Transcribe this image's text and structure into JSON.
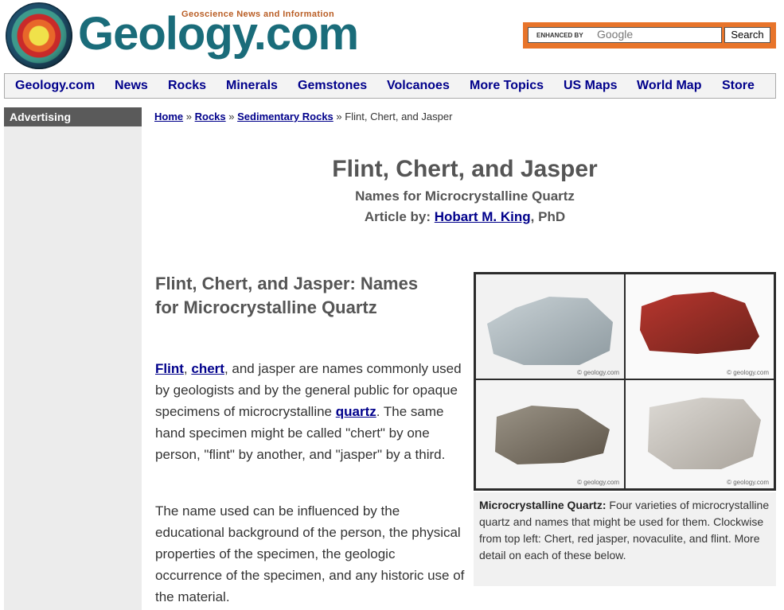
{
  "header": {
    "logo_text": "Geology.com",
    "tagline": "Geoscience News and Information",
    "search": {
      "enhanced_label": "ENHANCED BY",
      "google_label": "Google",
      "button_label": "Search"
    }
  },
  "nav": {
    "items": [
      {
        "label": "Geology.com"
      },
      {
        "label": "News"
      },
      {
        "label": "Rocks"
      },
      {
        "label": "Minerals"
      },
      {
        "label": "Gemstones"
      },
      {
        "label": "Volcanoes"
      },
      {
        "label": "More Topics"
      },
      {
        "label": "US Maps"
      },
      {
        "label": "World Map"
      },
      {
        "label": "Store"
      }
    ]
  },
  "sidebar": {
    "heading": "Advertising"
  },
  "breadcrumb": {
    "home": "Home",
    "rocks": "Rocks",
    "sedimentary": "Sedimentary Rocks",
    "current": "Flint, Chert, and Jasper",
    "sep": "»"
  },
  "article": {
    "title": "Flint, Chert, and Jasper",
    "subtitle": "Names for Microcrystalline Quartz",
    "byline_prefix": "Article by:",
    "author": "Hobart M. King",
    "author_suffix": ", PhD",
    "section_heading": "Flint, Chert, and Jasper: Names for Microcrystalline Quartz",
    "p1": {
      "link_flint": "Flint",
      "sep": ",",
      "link_chert": "chert",
      "text_a": ", and jasper are names commonly used by geologists and by the general public for opaque specimens of microcrystalline",
      "link_quartz": "quartz",
      "text_b": ". The same hand specimen might be called \"chert\" by one person, \"flint\" by another, and \"jasper\" by a third."
    },
    "p2": "The name used can be influenced by the educational background of the person, the physical properties of the specimen, the geologic occurrence of the specimen, and any historic use of the material."
  },
  "figure": {
    "watermark": "© geology.com",
    "caption_bold": "Microcrystalline Quartz:",
    "caption_text": " Four varieties of microcrystalline quartz and names that might be used for them. Clockwise from top left: Chert, red jasper, novaculite, and flint. More detail on each of these below."
  },
  "colors": {
    "link": "#00008b",
    "accent_orange": "#e8742a",
    "logo_teal": "#1a6c7a"
  }
}
